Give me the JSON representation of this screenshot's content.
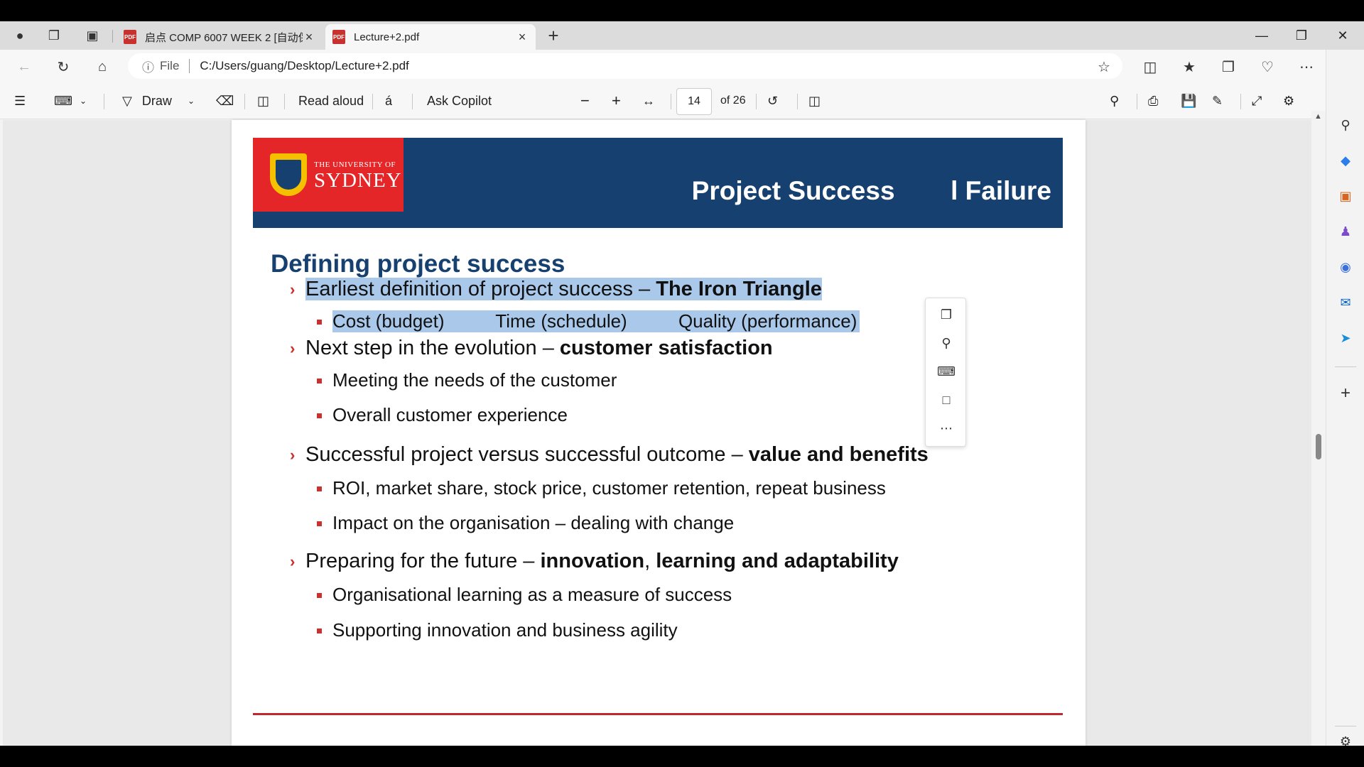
{
  "tabs": [
    {
      "label": "启点 COMP 6007 WEEK 2 [自动保存",
      "active": false
    },
    {
      "label": "Lecture+2.pdf",
      "active": true
    }
  ],
  "address": {
    "info_icon": "info-icon",
    "scheme_label": "File",
    "url": "C:/Users/guang/Desktop/Lecture+2.pdf"
  },
  "toolbar": {
    "draw_label": "Draw",
    "read_aloud_label": "Read aloud",
    "ask_copilot_label": "Ask Copilot",
    "page_current": "14",
    "page_total": "of 26"
  },
  "slide": {
    "logo_small": "THE UNIVERSITY OF",
    "logo_big": "SYDNEY",
    "banner_title_a": "Project Success",
    "banner_title_b": "l Failure",
    "heading": "Defining project success",
    "b1_text": "Earliest definition of project success – ",
    "b1_bold": "The Iron Triangle",
    "b1_sub": "Cost (budget)          Time (schedule)          Quality (performance)",
    "b2_text": "Next step in the evolution – ",
    "b2_bold": "customer satisfaction",
    "b2_sub1": "Meeting the needs of the customer",
    "b2_sub2": "Overall customer experience",
    "b3_text": "Successful project versus successful outcome – ",
    "b3_bold": "value and benefits",
    "b3_sub1": "ROI, market share, stock price, customer retention, repeat business",
    "b3_sub2": "Impact on the organisation – dealing with change",
    "b4_text": "Preparing for the future – ",
    "b4_bold1": "innovation",
    "b4_comma": ", ",
    "b4_bold2": "learning and adaptability",
    "b4_sub1": "Organisational learning as a measure of success",
    "b4_sub2": "Supporting innovation and business agility"
  },
  "colors": {
    "usyd_blue": "#16406f",
    "usyd_red": "#e52628",
    "bullet_red": "#c8312d",
    "selection": "#a9c8ea"
  }
}
